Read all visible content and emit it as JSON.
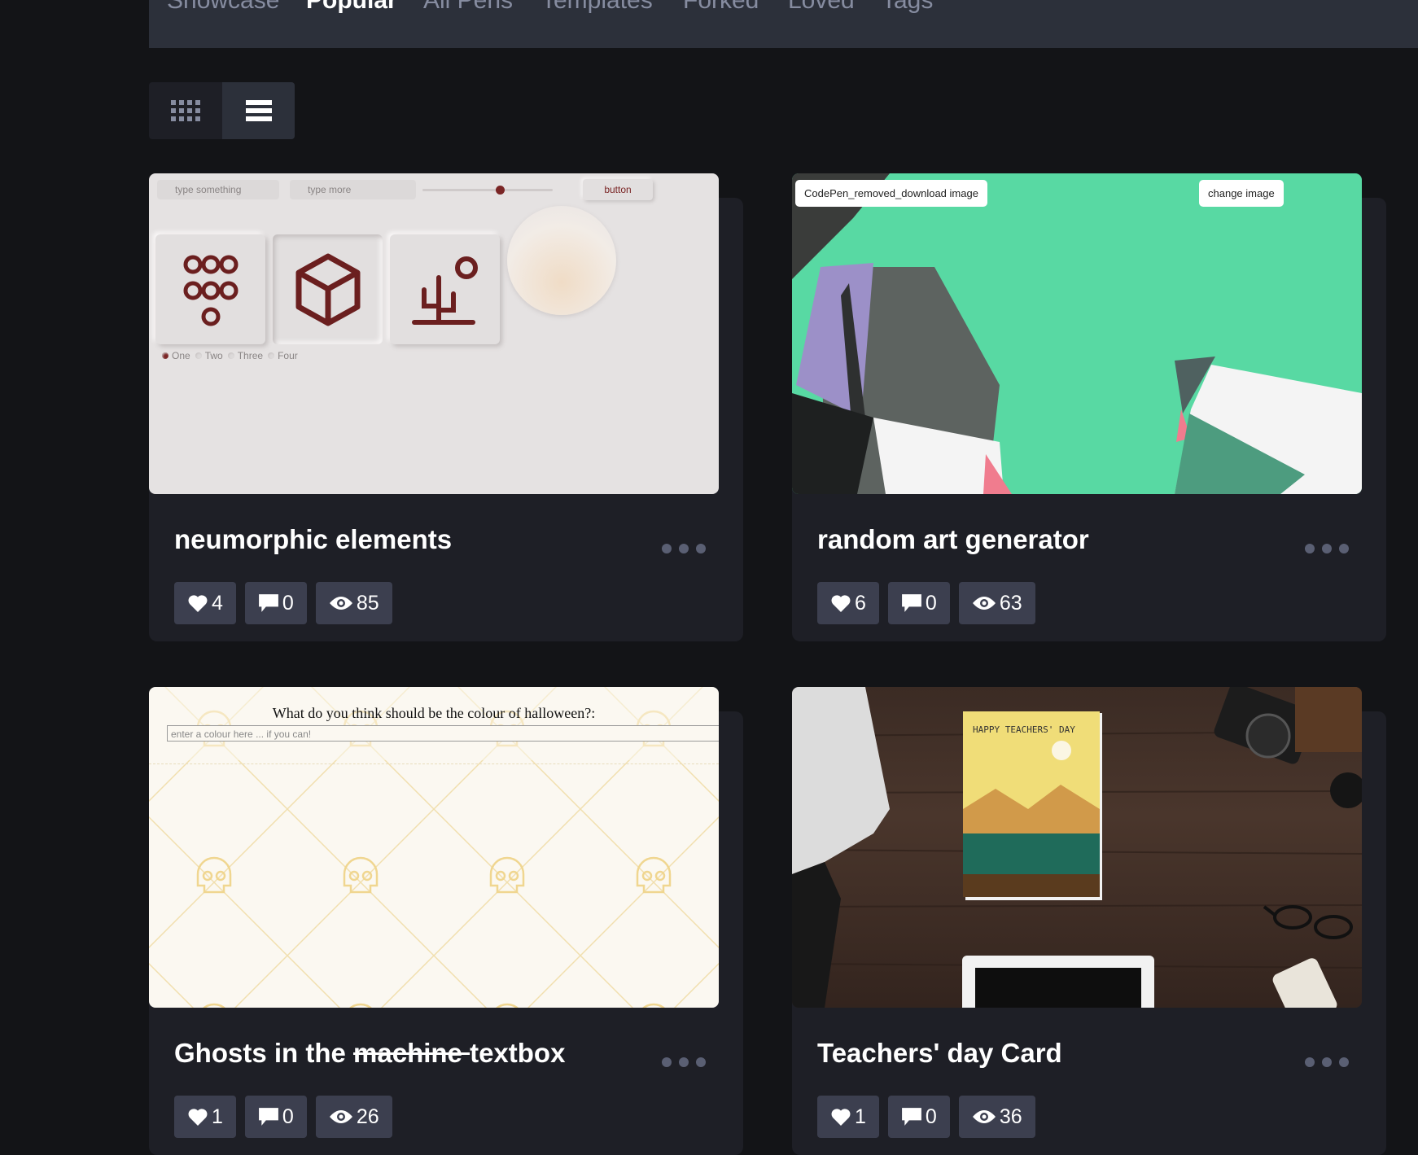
{
  "tabs": [
    {
      "label": "Showcase",
      "active": false
    },
    {
      "label": "Popular",
      "active": true
    },
    {
      "label": "All Pens",
      "active": false
    },
    {
      "label": "Templates",
      "active": false
    },
    {
      "label": "Forked",
      "active": false
    },
    {
      "label": "Loved",
      "active": false
    },
    {
      "label": "Tags",
      "active": false
    }
  ],
  "view_toggle": {
    "grid_icon": "grid-icon",
    "list_icon": "list-icon",
    "selected": "list"
  },
  "cards": [
    {
      "title": "neumorphic elements",
      "loves": "4",
      "comments": "0",
      "views": "85",
      "preview": {
        "input1": "type something",
        "input2": "type more",
        "button": "button",
        "radios": [
          "One",
          "Two",
          "Three",
          "Four"
        ]
      }
    },
    {
      "title": "random art generator",
      "loves": "6",
      "comments": "0",
      "views": "63",
      "preview": {
        "download_label": "CodePen_removed_download image",
        "change_label": "change image"
      }
    },
    {
      "title_prefix": "Ghosts in the ",
      "title_struck": "machine ",
      "title_suffix": "textbox",
      "loves": "1",
      "comments": "0",
      "views": "26",
      "preview": {
        "question": "What do you think should be the colour of halloween?:",
        "placeholder": "enter a colour here ... if you can!"
      }
    },
    {
      "title": "Teachers' day Card",
      "loves": "1",
      "comments": "0",
      "views": "36",
      "preview": {
        "card_text": "HAPPY TEACHERS' DAY"
      }
    }
  ],
  "colors": {
    "background": "#131417",
    "card": "#1e1f26",
    "stat": "#3c3f4f",
    "accent_green": "#58d9a3"
  }
}
